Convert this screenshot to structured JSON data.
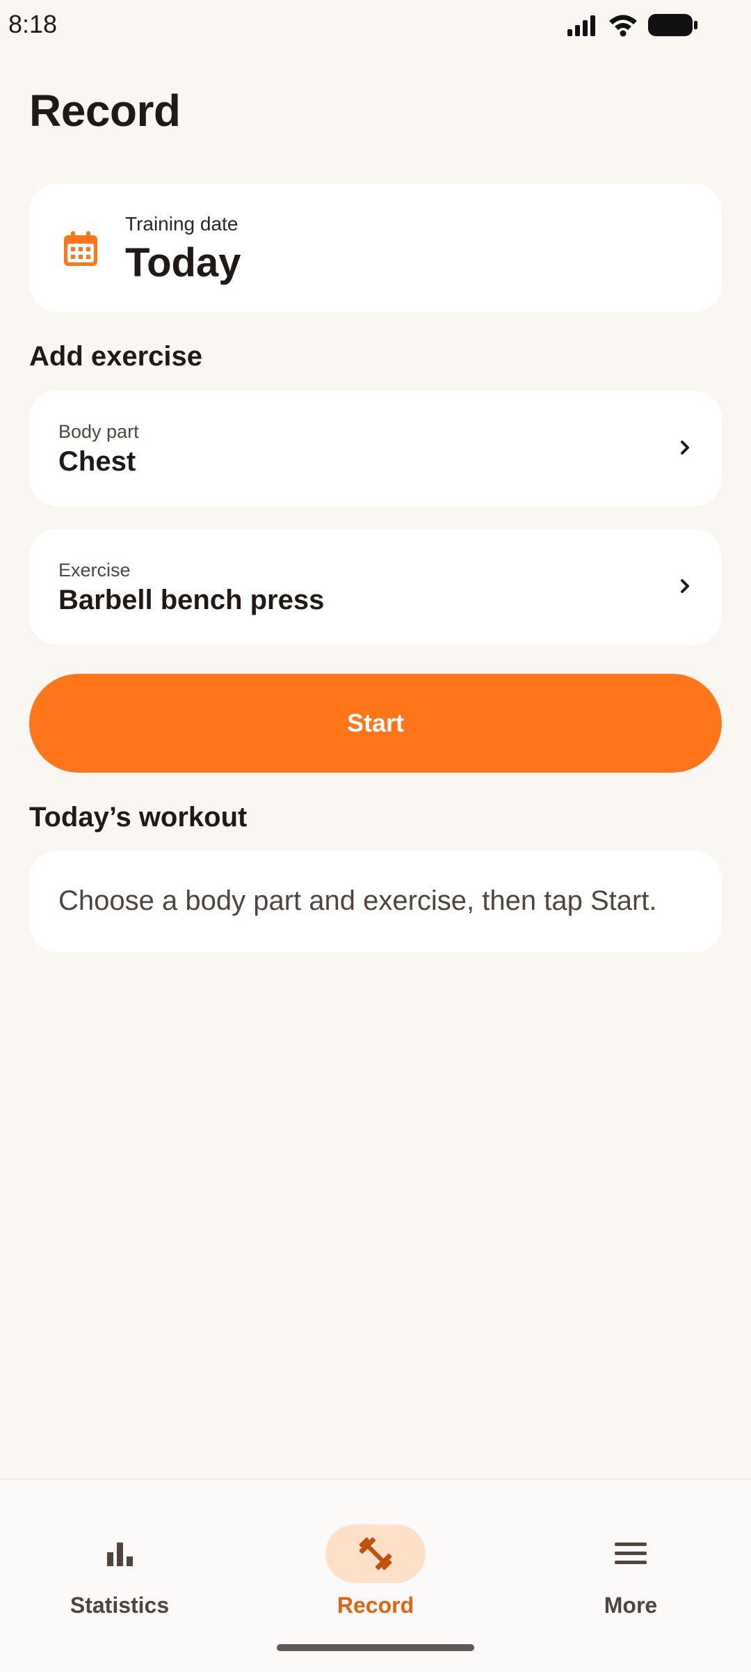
{
  "status_bar": {
    "time": "8:18",
    "icons": [
      "signal-icon",
      "wifi-icon",
      "battery-icon"
    ]
  },
  "page": {
    "title": "Record"
  },
  "training_date": {
    "icon": "calendar-icon",
    "label": "Training date",
    "value": "Today"
  },
  "add_exercise": {
    "title": "Add exercise",
    "body_part": {
      "label": "Body part",
      "value": "Chest"
    },
    "exercise": {
      "label": "Exercise",
      "value": "Barbell bench press"
    },
    "start_label": "Start"
  },
  "todays_workout": {
    "title": "Today’s workout",
    "empty_message": "Choose a body part and exercise, then tap Start."
  },
  "bottom_nav": {
    "items": [
      {
        "label": "Statistics",
        "icon": "bar-chart-icon",
        "active": false
      },
      {
        "label": "Record",
        "icon": "dumbbell-icon",
        "active": true
      },
      {
        "label": "More",
        "icon": "menu-icon",
        "active": false
      }
    ]
  },
  "colors": {
    "accent": "#ff761a",
    "accent_dark": "#e06511",
    "accent_soft": "#ffe0c8",
    "background": "#faf7f3",
    "card": "#ffffff",
    "text_primary": "#1f1a17",
    "text_secondary": "#4e4540"
  }
}
